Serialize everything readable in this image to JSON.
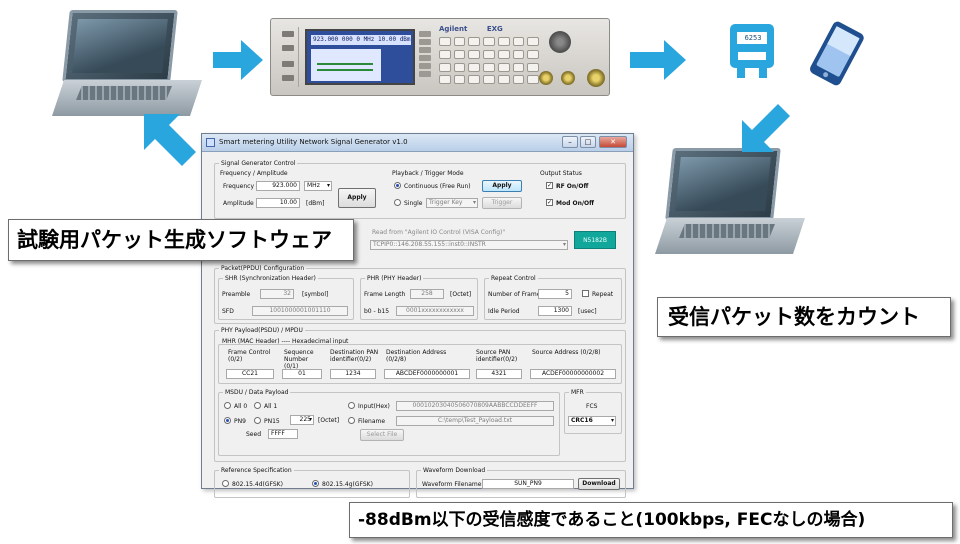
{
  "window": {
    "title": "Smart metering Utility Network Signal Generator v1.0",
    "min_glyph": "–",
    "max_glyph": "□",
    "close_glyph": "✕"
  },
  "signal_generator_control": {
    "group_title": "Signal Generator Control",
    "freq_amp_title": "Frequency / Amplitude",
    "frequency_label": "Frequency",
    "frequency_value": "923.000",
    "frequency_unit": "MHz",
    "amplitude_label": "Amplitude",
    "amplitude_value": "10.00",
    "amplitude_unit": "[dBm]",
    "apply_label": "Apply",
    "playback_title": "Playback / Trigger Mode",
    "continuous_label": "Continuous (Free Run)",
    "playback_apply_label": "Apply",
    "single_label": "Single",
    "trigger_key_value": "Trigger Key",
    "trigger_button_label": "Trigger",
    "output_title": "Output Status",
    "rf_label": "RF On/Off",
    "mod_label": "Mod On/Off"
  },
  "connection": {
    "read_from_label": "Read from \"Agilent IO Control (VISA Config)\"",
    "address_value": "TCPIP0::146.208.55.155::inst0::INSTR",
    "model_badge": "N5182B"
  },
  "packet": {
    "group_title": "Packet(PPDU) Configuration",
    "shr_title": "SHR (Synchronization Header)",
    "preamble_label": "Preamble",
    "preamble_value": "32",
    "preamble_unit": "[symbol]",
    "sfd_label": "SFD",
    "sfd_value": "1001000001001110",
    "phr_title": "PHR (PHY Header)",
    "frame_length_label": "Frame Length",
    "frame_length_value": "258",
    "frame_length_unit": "[Octet]",
    "b0_b15_label": "b0 - b15",
    "b0_b15_value": "0001xxxxxxxxxxxx",
    "repeat_title": "Repeat Control",
    "num_frame_label": "Number of Frame",
    "num_frame_value": "5",
    "repeat_label": "Repeat",
    "idle_label": "Idle Period",
    "idle_value": "1300",
    "idle_unit": "[usec]"
  },
  "phy_payload": {
    "group_title": "PHY Payload(PSDU) / MPDU",
    "mhr_title": "MHR (MAC Header) ---- Hexadecimal input",
    "frame_control_label": "Frame Control (0/2)",
    "frame_control_value": "CC21",
    "sequence_label": "Sequence Number (0/1)",
    "sequence_value": "01",
    "dest_pan_label": "Destination PAN identifier(0/2)",
    "dest_pan_value": "1234",
    "dest_addr_label": "Destination Address (0/2/8)",
    "dest_addr_value": "ABCDEF0000000001",
    "src_pan_label": "Source PAN identifier(0/2)",
    "src_pan_value": "4321",
    "src_addr_label": "Source Address (0/2/8)",
    "src_addr_value": "ACDEF00000000002"
  },
  "msdu": {
    "group_title": "MSDU / Data Payload",
    "all0_label": "All 0",
    "all1_label": "All 1",
    "pn9_label": "PN9",
    "pn15_label": "PN15",
    "octets_value": "225",
    "octets_unit": "[Octet]",
    "seed_label": "Seed",
    "seed_value": "FFFF",
    "input_hex_label": "Input(Hex)",
    "input_hex_value": "00010203040506070809AABBCCDDEEFF",
    "filename_label": "Filename",
    "filename_value": "C:\\temp\\Test_Payload.txt",
    "select_file_label": "Select File"
  },
  "mfr": {
    "group_title": "MFR",
    "fcs_label": "FCS",
    "fcs_value": "CRC16"
  },
  "reference": {
    "group_title": "Reference Specification",
    "opt_a": "802.15.4d(GFSK)",
    "opt_b": "802.15.4g(GFSK)"
  },
  "waveform": {
    "group_title": "Waveform Download",
    "filename_label": "Waveform Filename",
    "filename_value": "SUN_PN9",
    "download_label": "Download"
  },
  "instrument": {
    "brand_text": "Agilent",
    "model_text": "EXG",
    "display_readout": "923.000 000 0 MHz  10.00 dBm"
  },
  "meter": {
    "readout": "6253"
  },
  "captions": {
    "software": "試験用パケット生成ソフトウェア",
    "count": "受信パケット数をカウント",
    "sensitivity": "-88dBm以下の受信感度であること(100kbps, FECなしの場合)"
  },
  "colors": {
    "arrow": "#2aa6df",
    "teal_badge": "#12a79b"
  }
}
